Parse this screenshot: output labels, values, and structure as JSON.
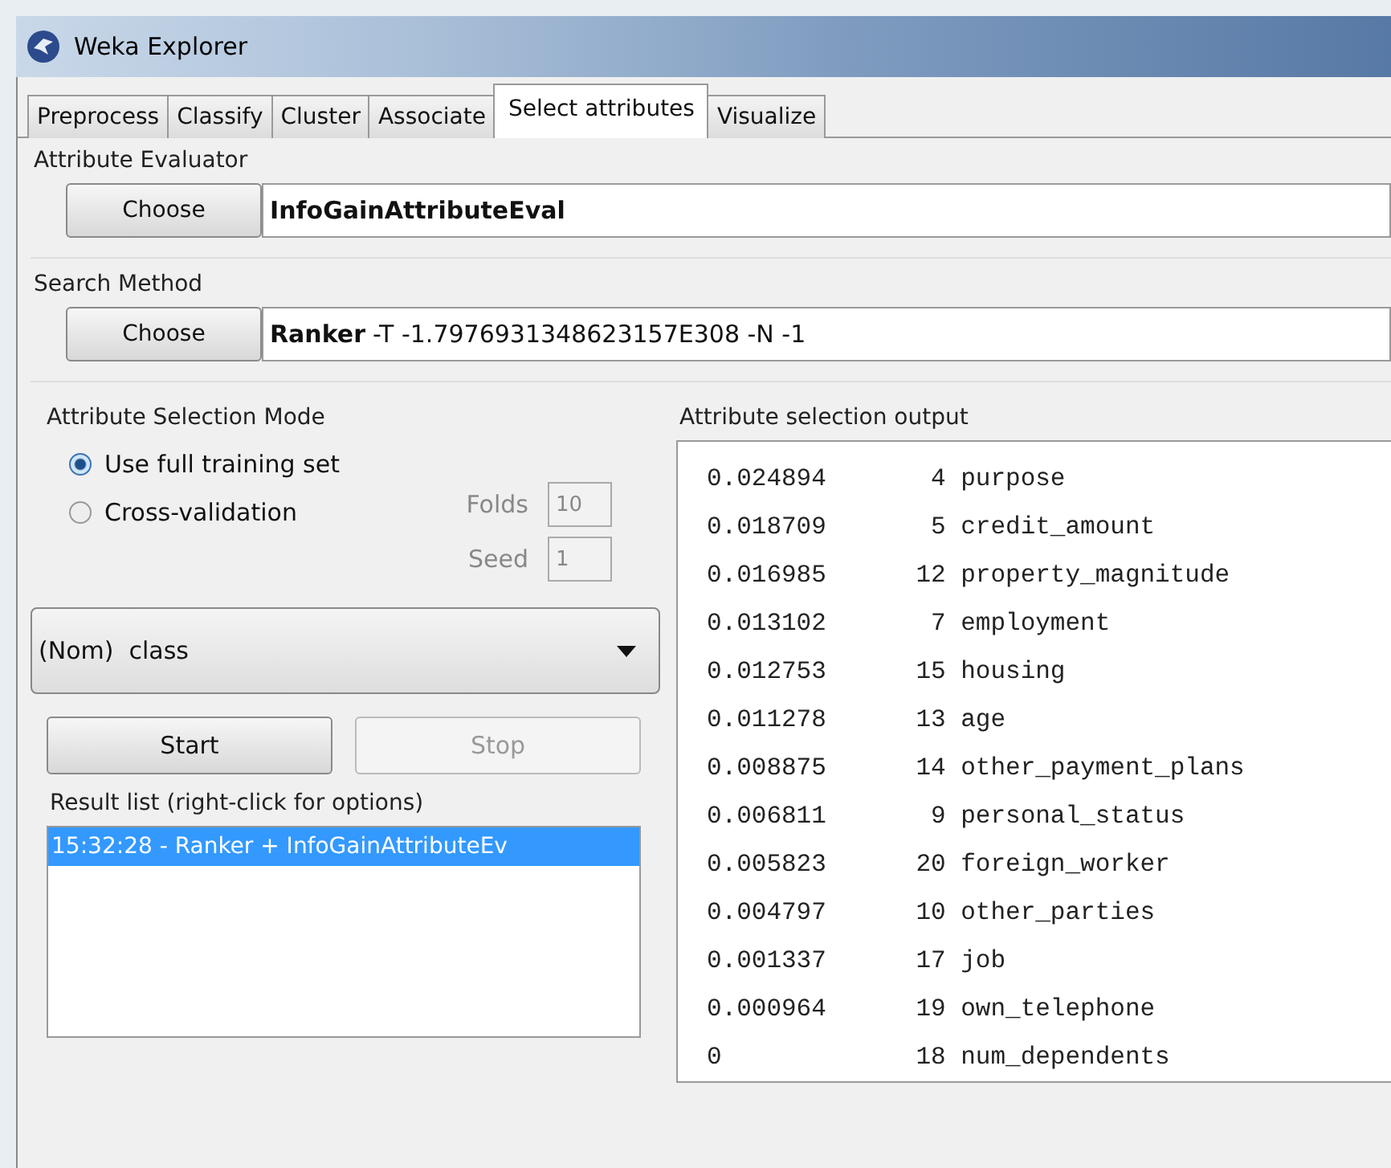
{
  "window": {
    "title": "Weka Explorer"
  },
  "tabs": [
    {
      "label": "Preprocess",
      "selected": false
    },
    {
      "label": "Classify",
      "selected": false
    },
    {
      "label": "Cluster",
      "selected": false
    },
    {
      "label": "Associate",
      "selected": false
    },
    {
      "label": "Select attributes",
      "selected": true
    },
    {
      "label": "Visualize",
      "selected": false
    }
  ],
  "evaluator": {
    "title": "Attribute Evaluator",
    "button": "Choose",
    "name": "InfoGainAttributeEval"
  },
  "search_method": {
    "title": "Search Method",
    "button": "Choose",
    "name": "Ranker",
    "options": "-T -1.7976931348623157E308 -N -1"
  },
  "selection_mode": {
    "title": "Attribute Selection Mode",
    "options": [
      {
        "label": "Use full training set",
        "selected": true
      },
      {
        "label": "Cross-validation",
        "selected": false
      }
    ],
    "folds": {
      "label": "Folds",
      "value": "10"
    },
    "seed": {
      "label": "Seed",
      "value": "1"
    }
  },
  "class_dropdown": {
    "value": "(Nom)  class"
  },
  "buttons": [
    {
      "label": "Start",
      "disabled": false
    },
    {
      "label": "Stop",
      "disabled": true
    }
  ],
  "result_list": {
    "title": "Result list (right-click for options)",
    "items": [
      {
        "label": "15:32:28 - Ranker + InfoGainAttributeEv",
        "selected": true
      }
    ]
  },
  "output": {
    "title": "Attribute selection output",
    "lines": [
      "0.024894       4 purpose",
      "0.018709       5 credit_amount",
      "0.016985      12 property_magnitude",
      "0.013102       7 employment",
      "0.012753      15 housing",
      "0.011278      13 age",
      "0.008875      14 other_payment_plans",
      "0.006811       9 personal_status",
      "0.005823      20 foreign_worker",
      "0.004797      10 other_parties",
      "0.001337      17 job",
      "0.000964      19 own_telephone",
      "0             18 num_dependents"
    ]
  }
}
